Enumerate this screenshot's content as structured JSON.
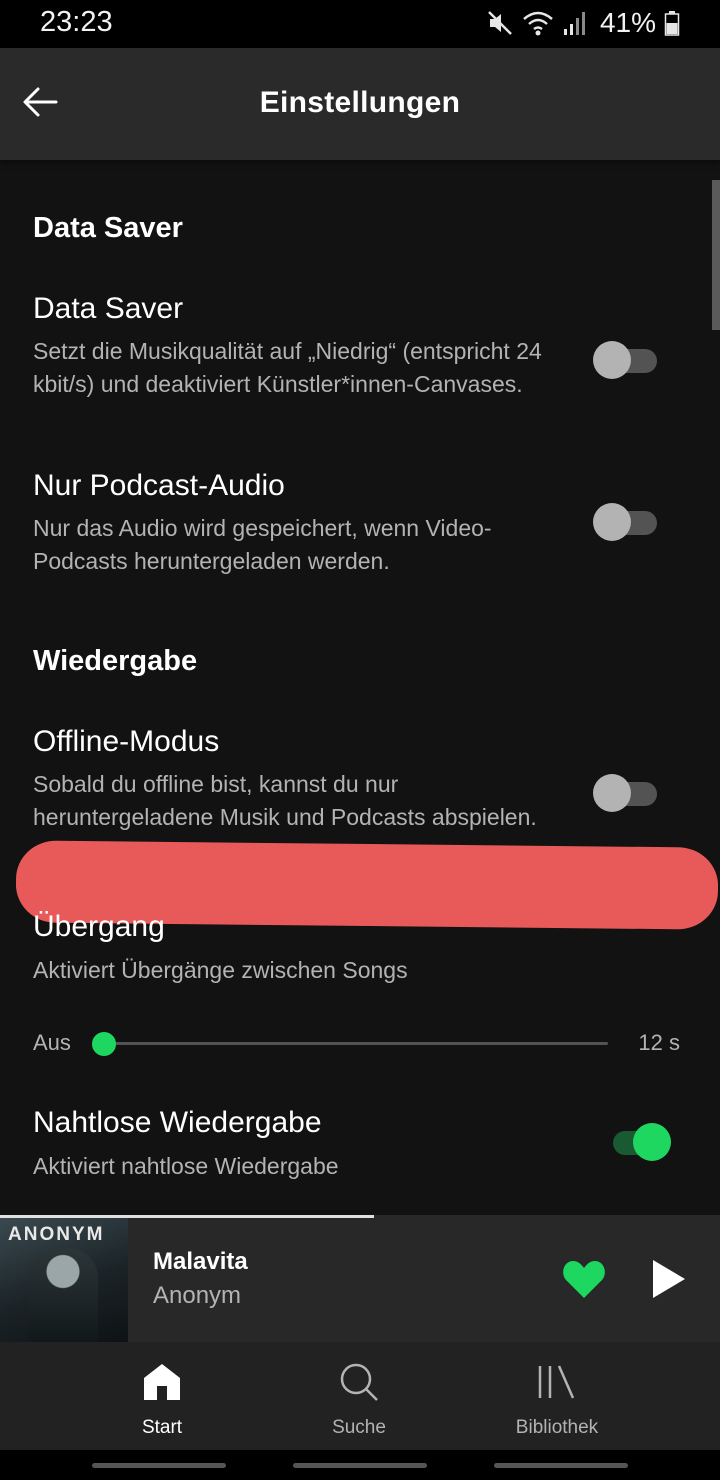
{
  "status_bar": {
    "time": "23:23",
    "battery": "41%",
    "icons": [
      "mute-icon",
      "wifi-icon",
      "signal-icon",
      "battery-icon"
    ]
  },
  "header": {
    "title": "Einstellungen",
    "back_icon": "arrow-left-icon"
  },
  "sections": {
    "data_saver": {
      "header": "Data Saver",
      "data_saver": {
        "title": "Data Saver",
        "desc": "Setzt die Musikqualität auf „Niedrig“ (entspricht 24 kbit/s) und deaktiviert Künstler*innen-Canvases.",
        "enabled": false
      },
      "podcast_audio": {
        "title": "Nur Podcast-Audio",
        "desc": "Nur das Audio wird gespeichert, wenn Video-Podcasts heruntergeladen werden.",
        "enabled": false
      }
    },
    "playback": {
      "header": "Wiedergabe",
      "offline": {
        "title": "Offline-Modus",
        "desc": "Sobald du offline bist, kannst du nur heruntergeladene Musik und Podcasts abspielen.",
        "enabled": false
      },
      "crossfade": {
        "title": "Übergang",
        "desc": "Aktiviert Übergänge zwischen Songs",
        "min_label": "Aus",
        "max_label": "12 s",
        "value_fraction": 0
      },
      "gapless": {
        "title": "Nahtlose Wiedergabe",
        "desc": "Aktiviert nahtlose Wiedergabe",
        "enabled": true
      }
    }
  },
  "now_playing": {
    "title": "Malavita",
    "artist": "Anonym",
    "cover_text": "ANONYM",
    "progress_fraction": 0.52,
    "liked": true
  },
  "bottom_nav": {
    "items": [
      {
        "label": "Start",
        "icon": "home-icon",
        "active": true
      },
      {
        "label": "Suche",
        "icon": "search-icon",
        "active": false
      },
      {
        "label": "Bibliothek",
        "icon": "library-icon",
        "active": false
      }
    ]
  },
  "colors": {
    "accent": "#1ed760",
    "background": "#121212",
    "app_bar": "#2a2a2a",
    "redaction": "#e85a5a"
  }
}
